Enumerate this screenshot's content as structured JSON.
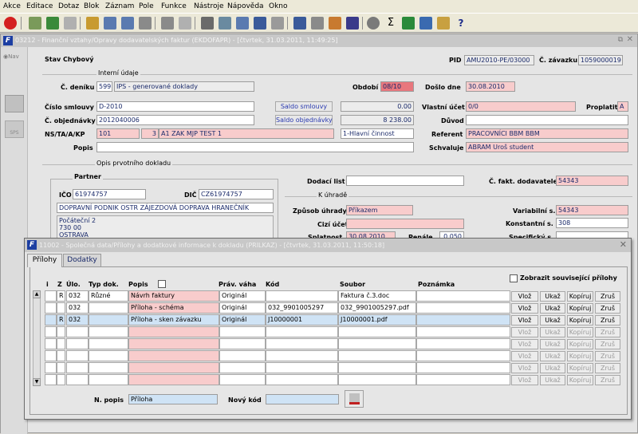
{
  "menu": [
    "Akce",
    "Editace",
    "Dotaz",
    "Blok",
    "Záznam",
    "Pole",
    "Funkce",
    "Nástroje",
    "Nápověda",
    "Okno"
  ],
  "main_window": {
    "title": "03212 - Finanční vztahy/Opravy dodavatelských faktur (EKDOFAPR) - [čtvrtek, 31.03.2011, 11:49:25]",
    "nav_label": "Nav",
    "stav_label": "Stav",
    "stav_value": "Chybový",
    "pid_label": "PID",
    "pid_value": "AMU2010-PE/03000",
    "zavazek_label": "Č. závazku",
    "zavazek_value": "1059000019",
    "interni_section": "Interní údaje",
    "cislo_deniku_label": "Č. deníku",
    "cislo_deniku_value": "599",
    "denik_desc": "IPS - generované doklady",
    "obdobi_label": "Období",
    "obdobi_value": "08/10",
    "doslo_label": "Došlo dne",
    "doslo_value": "30.08.2010",
    "smlouva_label": "Číslo smlouvy",
    "smlouva_value": "D-2010",
    "saldo_smlouvy_btn": "Saldo smlouvy",
    "saldo_smlouvy_value": "0.00",
    "vlastni_ucet_label": "Vlastní účet",
    "vlastni_ucet_value": "0/0",
    "proplatit_label": "Proplatit",
    "proplatit_value": "A",
    "objednavka_label": "Č. objednávky",
    "objednavka_value": "2012040006",
    "saldo_objednavky_btn": "Saldo objednávky",
    "saldo_objednavky_value": "8 238.00",
    "duvod_label": "Důvod",
    "ns_label": "NS/TA/A/KP",
    "ns_value": "101",
    "ta_value": "3",
    "a_value": "A1 ZAK MJP TEST 1",
    "kp_value": "1-Hlavní činnost",
    "referent_label": "Referent",
    "referent_value": "PRACOVNÍCI BBM BBM",
    "popis_label": "Popis",
    "schvaluje_label": "Schvaluje",
    "schvaluje_value": "ABRAM Uroš student",
    "opis_section": "Opis prvotního dokladu",
    "partner_section": "Partner",
    "ico_label": "IČO",
    "ico_value": "61974757",
    "dic_label": "DIČ",
    "dic_value": "CZ61974757",
    "partner_name": "DOPRAVNÍ PODNIK OSTR ZÁJEZDOVÁ DOPRAVA HRANEČNÍK",
    "partner_lines": [
      "Počáteční 2",
      "730 00",
      "OSTRAVA"
    ],
    "dodaci_label": "Dodací list",
    "fakt_label": "Č. fakt. dodavatele",
    "fakt_value": "54343",
    "uhrade_section": "K úhradě",
    "zpusob_label": "Způsob úhrady",
    "zpusob_value": "Příkazem",
    "cizi_label": "Cizí účet",
    "splatnost_label": "Splatnost",
    "splatnost_value": "30.08.2010",
    "penale_label": "Penále",
    "penale_value": "0.050",
    "vs_label": "Variabilní s.",
    "vs_value": "54343",
    "ks_label": "Konstantní s.",
    "ks_value": "308",
    "ss_label": "Specifický s."
  },
  "dialog": {
    "title": "11002 - Společná data/Přílohy a dodatkové informace k dokladu (PRILKAZ) - [čtvrtek, 31.03.2011, 11:50:18]",
    "tabs": [
      "Přílohy",
      "Dodatky"
    ],
    "columns": {
      "i": "i",
      "z": "Z",
      "ulo": "Úlo.",
      "typ": "Typ dok.",
      "popis": "Popis",
      "prav": "Práv. váha",
      "kod": "Kód",
      "soubor": "Soubor",
      "poznamka": "Poznámka"
    },
    "show_related": "Zobrazit související přílohy",
    "rows": [
      {
        "z": "R",
        "ulo": "032",
        "typ": "Různé",
        "popis": "Návrh faktury",
        "prav": "Originál",
        "kod": "",
        "soubor": "Faktura č.3.doc",
        "poznamka": ""
      },
      {
        "z": "",
        "ulo": "032",
        "typ": "",
        "popis": "Příloha - schéma",
        "prav": "Originál",
        "kod": "032_9901005297",
        "soubor": "032_9901005297.pdf",
        "poznamka": ""
      },
      {
        "z": "R",
        "ulo": "032",
        "typ": "",
        "popis": "Příloha - sken závazku",
        "prav": "Originál",
        "kod": "J10000001",
        "soubor": "J10000001.pdf",
        "poznamka": ""
      }
    ],
    "row_buttons": [
      "Vlož",
      "Ukaž",
      "Kopíruj",
      "Zruš"
    ],
    "n_popis_label": "N. popis",
    "n_popis_value": "Příloha",
    "novy_kod_label": "Nový kód"
  }
}
